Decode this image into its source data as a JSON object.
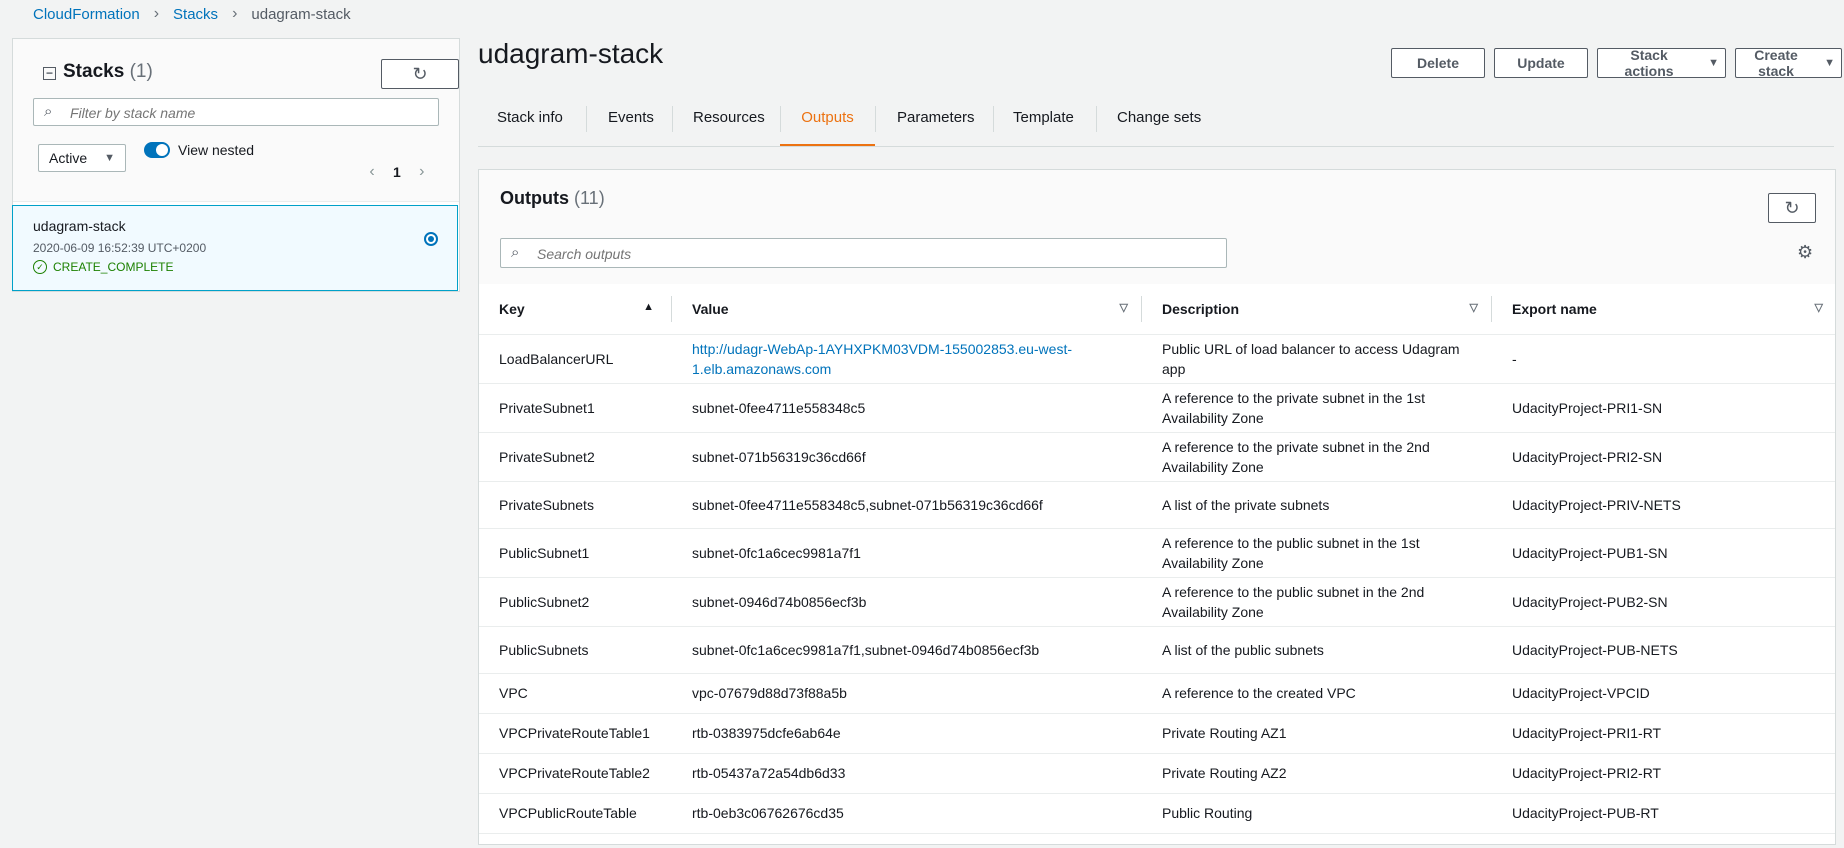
{
  "breadcrumb": [
    "CloudFormation",
    "Stacks",
    "udagram-stack"
  ],
  "stacks_panel": {
    "title": "Stacks",
    "count": "(1)",
    "filter_placeholder": "Filter by stack name",
    "status_filter": "Active",
    "view_nested_label": "View nested",
    "view_nested_enabled": true,
    "page": "1",
    "items": [
      {
        "name": "udagram-stack",
        "date": "2020-06-09 16:52:39 UTC+0200",
        "status": "CREATE_COMPLETE",
        "selected": true
      }
    ]
  },
  "header": {
    "title": "udagram-stack",
    "buttons": {
      "delete": "Delete",
      "update": "Update",
      "stack_actions": "Stack actions",
      "create_stack": "Create stack"
    }
  },
  "tabs": [
    "Stack info",
    "Events",
    "Resources",
    "Outputs",
    "Parameters",
    "Template",
    "Change sets"
  ],
  "active_tab": "Outputs",
  "outputs": {
    "title": "Outputs",
    "count": "(11)",
    "search_placeholder": "Search outputs",
    "columns": [
      "Key",
      "Value",
      "Description",
      "Export name"
    ],
    "sort": {
      "column": "Key",
      "direction": "ascending"
    },
    "rows": [
      {
        "key": "LoadBalancerURL",
        "value": "http://udagr-WebAp-1AYHXPKM03VDM-155002853.eu-west-1.elb.amazonaws.com",
        "description": "Public URL of load balancer to access Udagram app",
        "export": "-"
      },
      {
        "key": "PrivateSubnet1",
        "value": "subnet-0fee4711e558348c5",
        "description": "A reference to the private subnet in the 1st Availability Zone",
        "export": "UdacityProject-PRI1-SN"
      },
      {
        "key": "PrivateSubnet2",
        "value": "subnet-071b56319c36cd66f",
        "description": "A reference to the private subnet in the 2nd Availability Zone",
        "export": "UdacityProject-PRI2-SN"
      },
      {
        "key": "PrivateSubnets",
        "value": "subnet-0fee4711e558348c5,subnet-071b56319c36cd66f",
        "description": "A list of the private subnets",
        "export": "UdacityProject-PRIV-NETS"
      },
      {
        "key": "PublicSubnet1",
        "value": "subnet-0fc1a6cec9981a7f1",
        "description": "A reference to the public subnet in the 1st Availability Zone",
        "export": "UdacityProject-PUB1-SN"
      },
      {
        "key": "PublicSubnet2",
        "value": "subnet-0946d74b0856ecf3b",
        "description": "A reference to the public subnet in the 2nd Availability Zone",
        "export": "UdacityProject-PUB2-SN"
      },
      {
        "key": "PublicSubnets",
        "value": "subnet-0fc1a6cec9981a7f1,subnet-0946d74b0856ecf3b",
        "description": "A list of the public subnets",
        "export": "UdacityProject-PUB-NETS"
      },
      {
        "key": "VPC",
        "value": "vpc-07679d88d73f88a5b",
        "description": "A reference to the created VPC",
        "export": "UdacityProject-VPCID"
      },
      {
        "key": "VPCPrivateRouteTable1",
        "value": "rtb-0383975dcfe6ab64e",
        "description": "Private Routing AZ1",
        "export": "UdacityProject-PRI1-RT"
      },
      {
        "key": "VPCPrivateRouteTable2",
        "value": "rtb-05437a72a54db6d33",
        "description": "Private Routing AZ2",
        "export": "UdacityProject-PRI2-RT"
      },
      {
        "key": "VPCPublicRouteTable",
        "value": "rtb-0eb3c06762676cd35",
        "description": "Public Routing",
        "export": "UdacityProject-PUB-RT"
      }
    ]
  },
  "colors": {
    "link": "#0073bb",
    "active_tab": "#ec7211",
    "success": "#1d8102",
    "selected_border": "#00a1c9"
  }
}
